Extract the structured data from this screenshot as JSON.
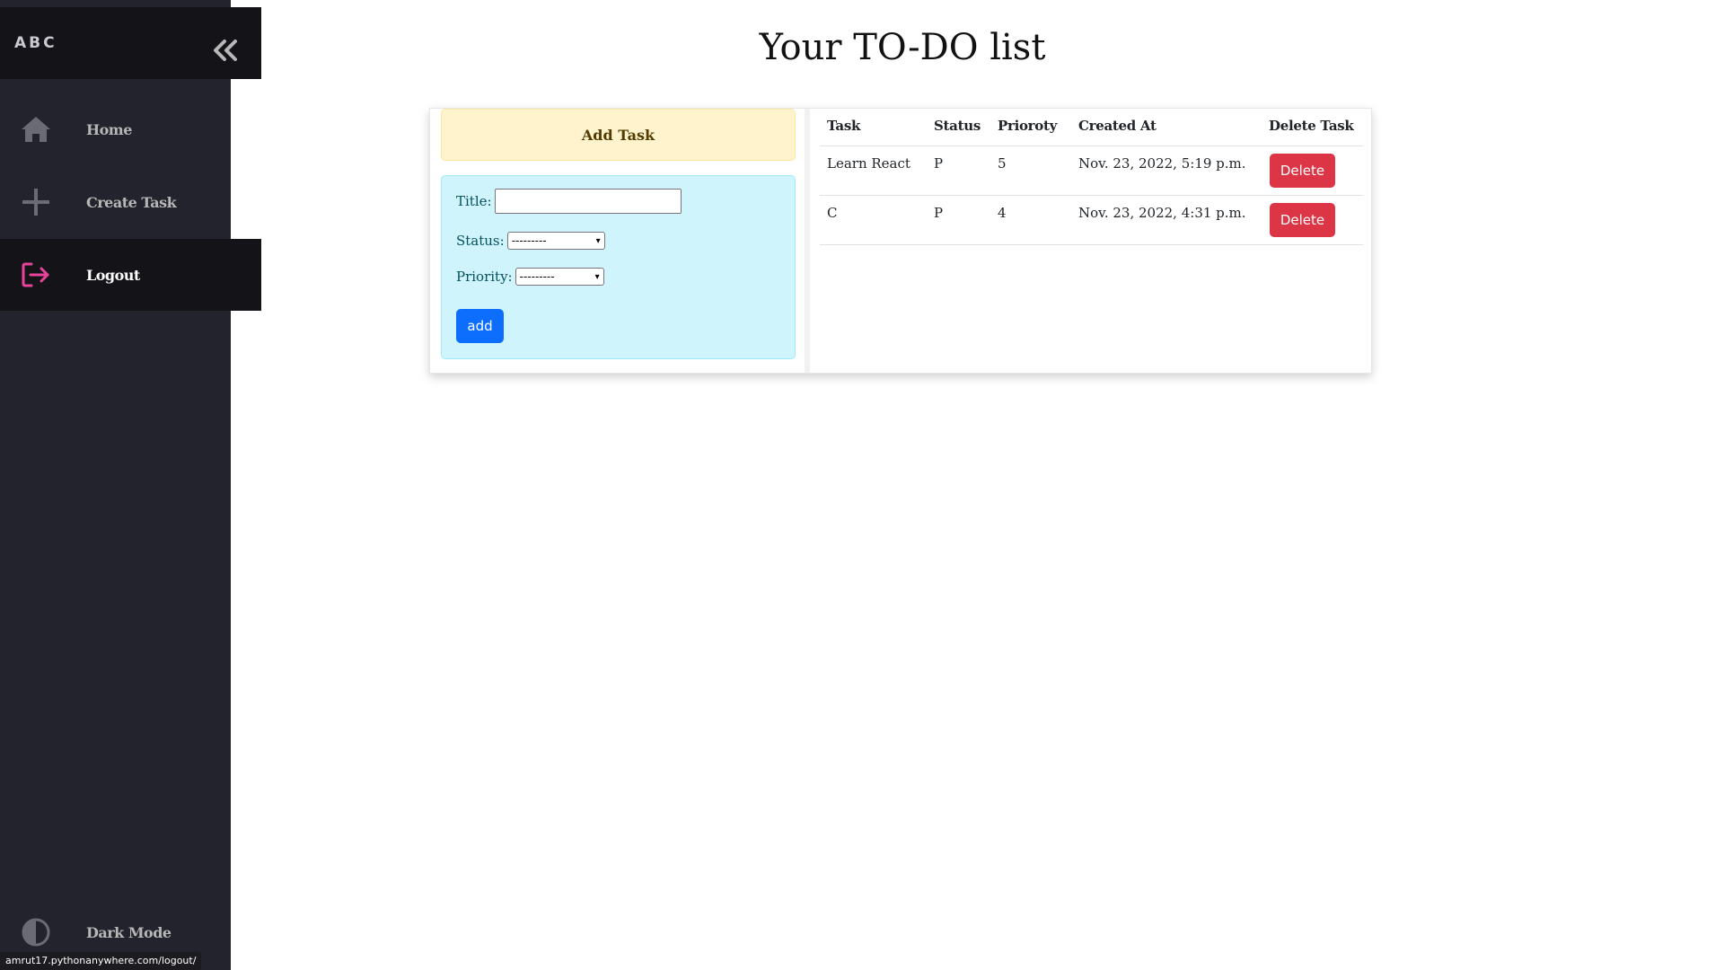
{
  "sidebar": {
    "brand": "ABC",
    "items": [
      {
        "label": "Home",
        "icon": "home-icon"
      },
      {
        "label": "Create Task",
        "icon": "plus-icon"
      },
      {
        "label": "Logout",
        "icon": "logout-icon",
        "active": true
      }
    ],
    "dark_mode_label": "Dark Mode"
  },
  "status_bar": {
    "url": "amrut17.pythonanywhere.com/logout/"
  },
  "page": {
    "title": "Your TO-DO list"
  },
  "add_task": {
    "header": "Add Task",
    "title_label": "Title:",
    "title_value": "",
    "status_label": "Status:",
    "status_value": "---------",
    "priority_label": "Priority:",
    "priority_value": "---------",
    "submit_label": "add"
  },
  "table": {
    "headers": [
      "Task",
      "Status",
      "Prioroty",
      "Created At",
      "Delete Task"
    ],
    "rows": [
      {
        "task": "Learn React",
        "status": "P",
        "priority": "5",
        "created": "Nov. 23, 2022, 5:19 p.m.",
        "delete": "Delete"
      },
      {
        "task": "C",
        "status": "P",
        "priority": "4",
        "created": "Nov. 23, 2022, 4:31 p.m.",
        "delete": "Delete"
      }
    ]
  },
  "colors": {
    "sidebar_bg": "#23232e",
    "sidebar_active_bg": "#141418",
    "logout_accent": "#e8439b",
    "add_header_bg": "#fff3cd",
    "form_bg": "#cff4fc",
    "add_button": "#0d6efd",
    "delete_button": "#dc3545"
  }
}
